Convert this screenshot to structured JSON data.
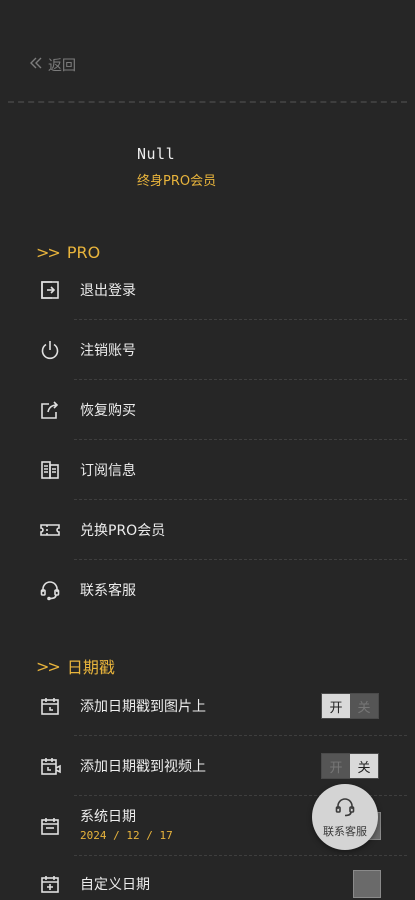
{
  "header": {
    "back_label": "返回"
  },
  "user": {
    "name": "Null",
    "level": "终身PRO会员"
  },
  "sections": {
    "pro": {
      "title": "PRO",
      "items": [
        {
          "label": "退出登录",
          "icon": "logout-icon"
        },
        {
          "label": "注销账号",
          "icon": "power-icon"
        },
        {
          "label": "恢复购买",
          "icon": "share-icon"
        },
        {
          "label": "订阅信息",
          "icon": "document-icon"
        },
        {
          "label": "兑换PRO会员",
          "icon": "ticket-icon"
        },
        {
          "label": "联系客服",
          "icon": "headset-icon"
        }
      ]
    },
    "date": {
      "title": "日期戳",
      "photo_stamp": {
        "label": "添加日期戳到图片上",
        "on": "开",
        "off": "关",
        "state": "on"
      },
      "video_stamp": {
        "label": "添加日期戳到视频上",
        "on": "开",
        "off": "关",
        "state": "off"
      },
      "system_date": {
        "label": "系统日期",
        "value": "2024 / 12 / 17"
      },
      "custom_date": {
        "label": "自定义日期"
      }
    }
  },
  "fab": {
    "label": "联系客服",
    "icon": "headset-icon"
  },
  "colors": {
    "background": "#262626",
    "accent": "#e8b43c",
    "text": "#ececec"
  }
}
